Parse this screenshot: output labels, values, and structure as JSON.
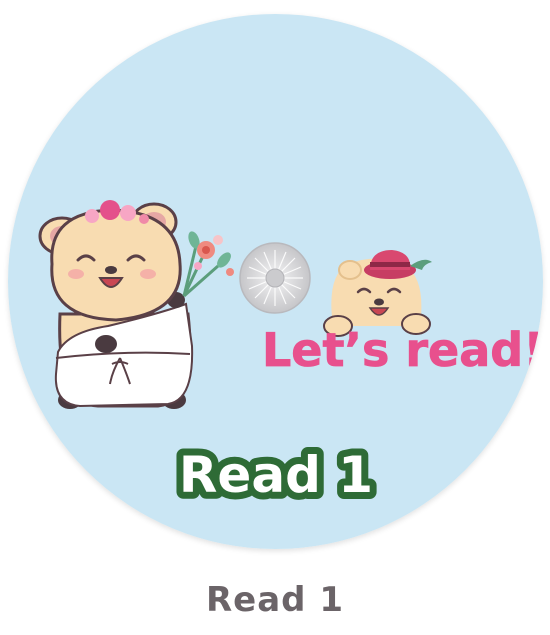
{
  "disc": {
    "headline": "Let’s read!",
    "label": "Read 1"
  },
  "caption": {
    "text": "Read 1"
  },
  "colors": {
    "disc_background": "#cae6f4",
    "headline_pink": "#e8508d",
    "label_fill": "#ffffff",
    "label_outline": "#2e6b36",
    "caption_gray": "#6b6468",
    "hub_gray": "#d2d2d4",
    "bear_fur": "#f8dcb1"
  },
  "icons": {
    "bride_bear": "bear-with-flowers-icon",
    "hat_bear": "bear-with-hat-icon",
    "hub": "disc-hub-icon"
  }
}
